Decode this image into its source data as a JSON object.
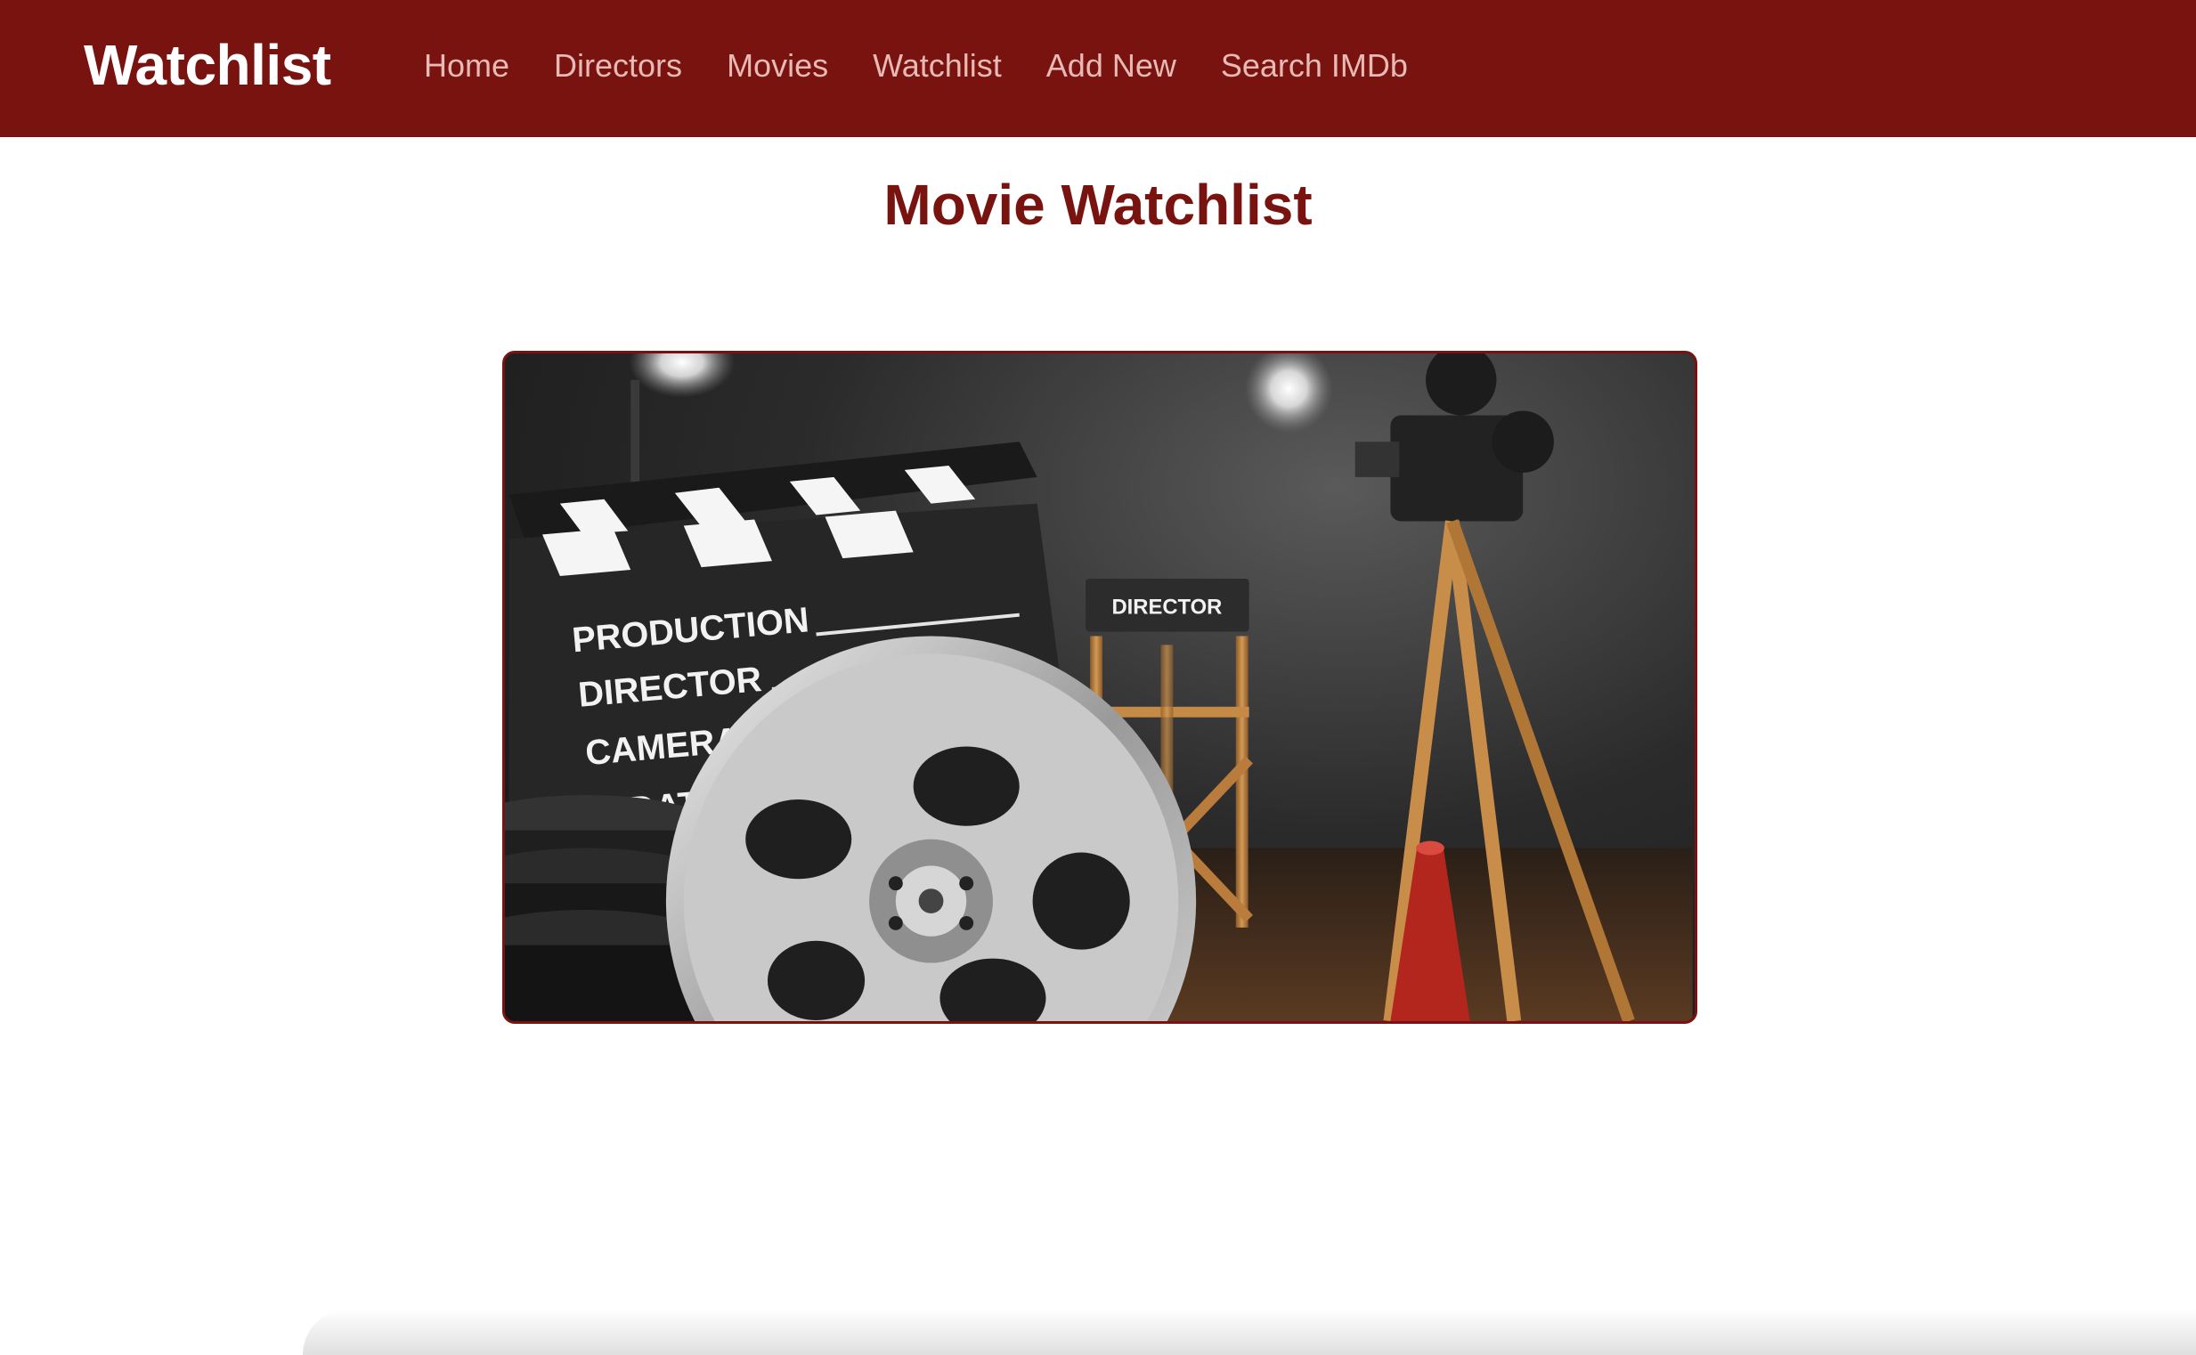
{
  "navbar": {
    "brand": "Watchlist",
    "links": [
      {
        "label": "Home"
      },
      {
        "label": "Directors"
      },
      {
        "label": "Movies"
      },
      {
        "label": "Watchlist"
      },
      {
        "label": "Add New"
      },
      {
        "label": "Search IMDb"
      }
    ]
  },
  "main": {
    "title": "Movie Watchlist",
    "hero": {
      "clapboard_lines": [
        "PRODUCTION",
        "DIRECTOR",
        "CAMERA",
        "DAT"
      ],
      "chair_label": "DIRECTOR"
    }
  },
  "colors": {
    "brand": "#781310",
    "nav_link": "#e8b9b5",
    "background": "#ffffff"
  }
}
